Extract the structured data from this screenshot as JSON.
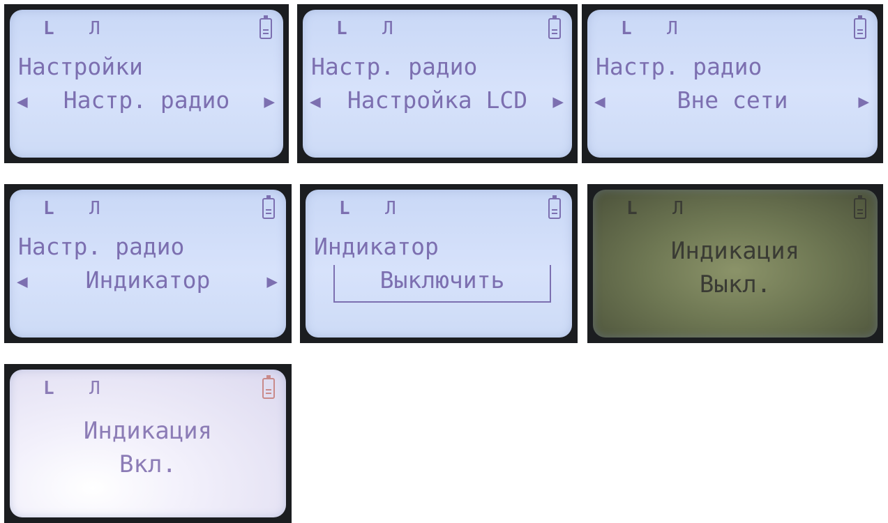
{
  "screens": {
    "s1": {
      "ind_l": "L",
      "ind_p": "Л",
      "title": "Настройки",
      "item": "Настр. радио",
      "arrow_left": "◀",
      "arrow_right": "▶"
    },
    "s2": {
      "ind_l": "L",
      "ind_p": "Л",
      "title": "Настр. радио",
      "item": "Настройка LCD",
      "arrow_left": "◀",
      "arrow_right": "▶"
    },
    "s3": {
      "ind_l": "L",
      "ind_p": "Л",
      "title": "Настр. радио",
      "item": "Вне сети",
      "arrow_left": "◀",
      "arrow_right": "▶"
    },
    "s4": {
      "ind_l": "L",
      "ind_p": "Л",
      "title": "Настр. радио",
      "item": "Индикатор",
      "arrow_left": "◀",
      "arrow_right": "▶"
    },
    "s5": {
      "ind_l": "L",
      "ind_p": "Л",
      "title": "Индикатор",
      "item": "Выключить"
    },
    "s6": {
      "ind_l": "L",
      "ind_p": "Л",
      "line1": "Индикация",
      "line2": "Выкл."
    },
    "s7": {
      "ind_l": "L",
      "ind_p": "Л",
      "line1": "Индикация",
      "line2": "Вкл."
    }
  },
  "colors": {
    "lcd_text": "#7c6fb0",
    "lcd_bg": "#d1ddf8",
    "dim_bg": "#6e7753",
    "bezel": "#1b1d20"
  },
  "icons": {
    "battery": "battery-icon",
    "arrow_left": "arrow-left-icon",
    "arrow_right": "arrow-right-icon",
    "pulse": "pulse-icon"
  }
}
